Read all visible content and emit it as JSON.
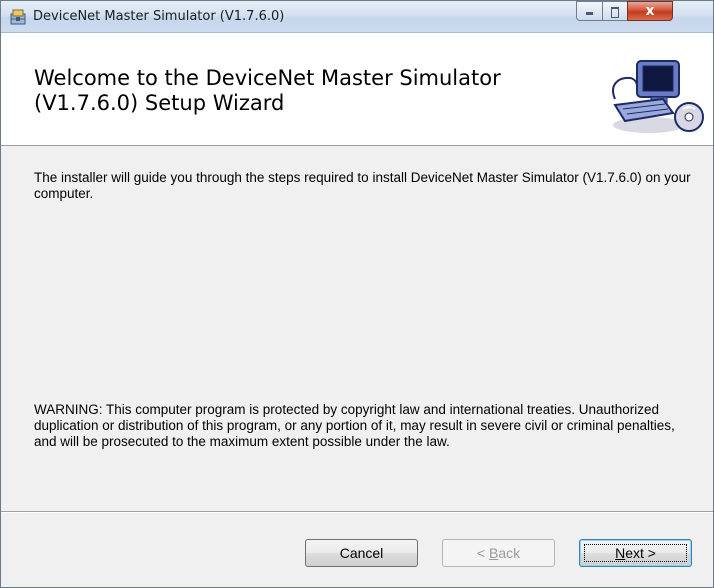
{
  "window": {
    "title": "DeviceNet Master Simulator (V1.7.6.0)",
    "close_glyph": "x"
  },
  "banner": {
    "heading_line1": "Welcome to the DeviceNet Master Simulator",
    "heading_line2": "(V1.7.6.0) Setup Wizard"
  },
  "content": {
    "intro": "The installer will guide you through the steps required to install DeviceNet Master Simulator (V1.7.6.0) on your computer.",
    "warning": "WARNING: This computer program is protected by copyright law and international treaties. Unauthorized duplication or distribution of this program, or any portion of it, may result in severe civil or criminal penalties, and will be prosecuted to the maximum extent possible under the law."
  },
  "buttons": {
    "cancel": "Cancel",
    "back_prefix": "< ",
    "back_mnemonic": "B",
    "back_rest": "ack",
    "next_mnemonic": "N",
    "next_rest": "ext >"
  },
  "icons": {
    "app": "installer-icon",
    "banner": "computer-setup-icon"
  },
  "colors": {
    "dialog_bg": "#f0f0f0",
    "close_button": "#c33b20",
    "default_button_border": "#3c7fb1"
  }
}
